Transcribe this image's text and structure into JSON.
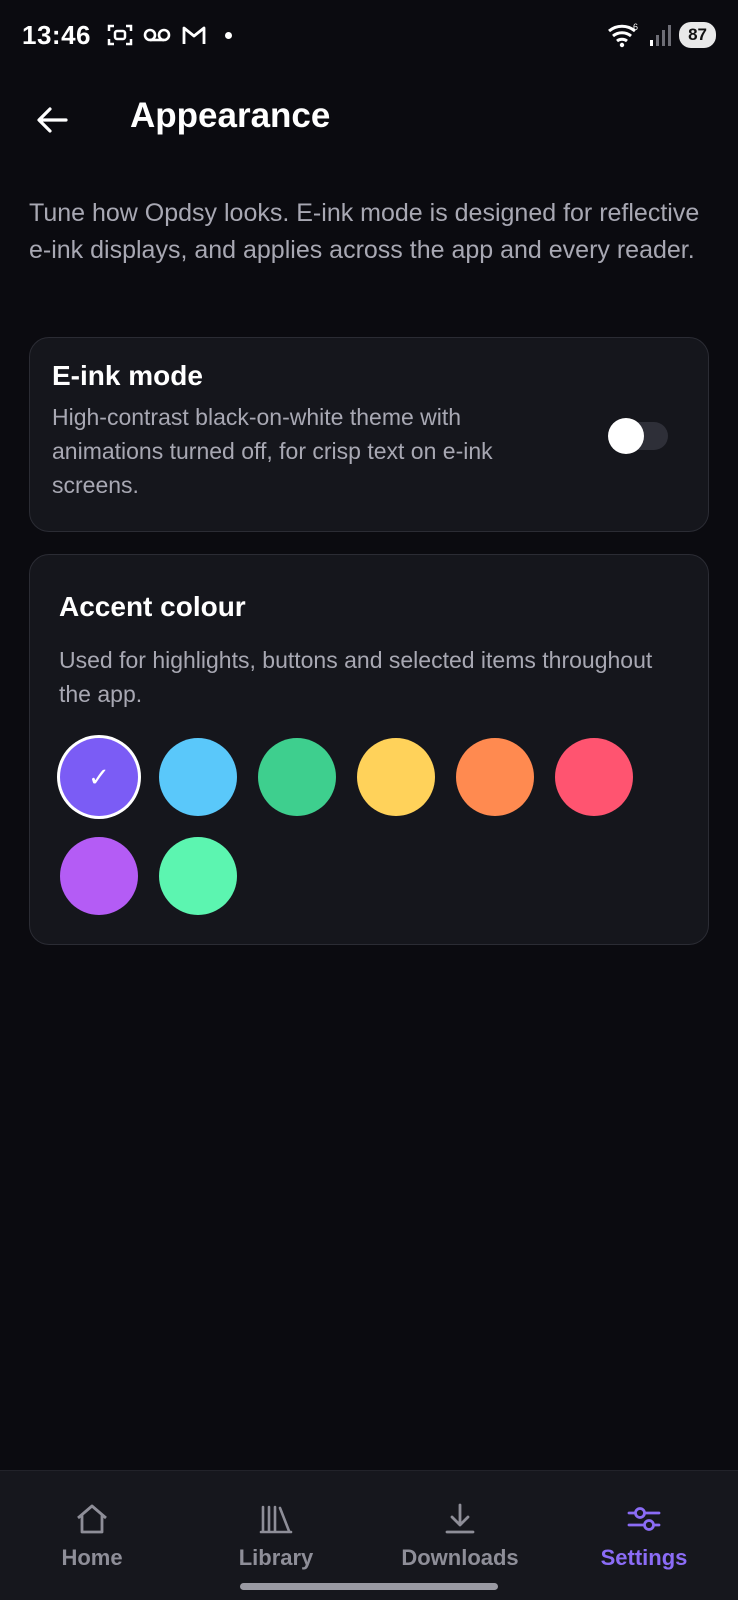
{
  "status_bar": {
    "time": "13:46",
    "battery": "87",
    "wifi_badge": "6"
  },
  "header": {
    "title": "Appearance"
  },
  "intro": "Tune how Opdsy looks. E-ink mode is designed for reflective e-ink displays, and applies across the app and every reader.",
  "eink": {
    "title": "E-ink mode",
    "description": "High-contrast black-on-white theme with animations turned off, for crisp text on e-ink screens.",
    "enabled": false
  },
  "accent": {
    "title": "Accent colour",
    "description": "Used for highlights, buttons and selected items throughout the app.",
    "selected_index": 0,
    "colors": [
      "#7b5cf5",
      "#5ac8fa",
      "#3ecf8e",
      "#ffd25a",
      "#ff8a50",
      "#ff5470",
      "#b45cf5",
      "#5cf5b0"
    ]
  },
  "nav": {
    "items": [
      {
        "label": "Home",
        "icon": "home-icon"
      },
      {
        "label": "Library",
        "icon": "library-icon"
      },
      {
        "label": "Downloads",
        "icon": "download-icon"
      },
      {
        "label": "Settings",
        "icon": "settings-sliders-icon"
      }
    ],
    "active_index": 3,
    "active_color": "#8b6cf6"
  }
}
